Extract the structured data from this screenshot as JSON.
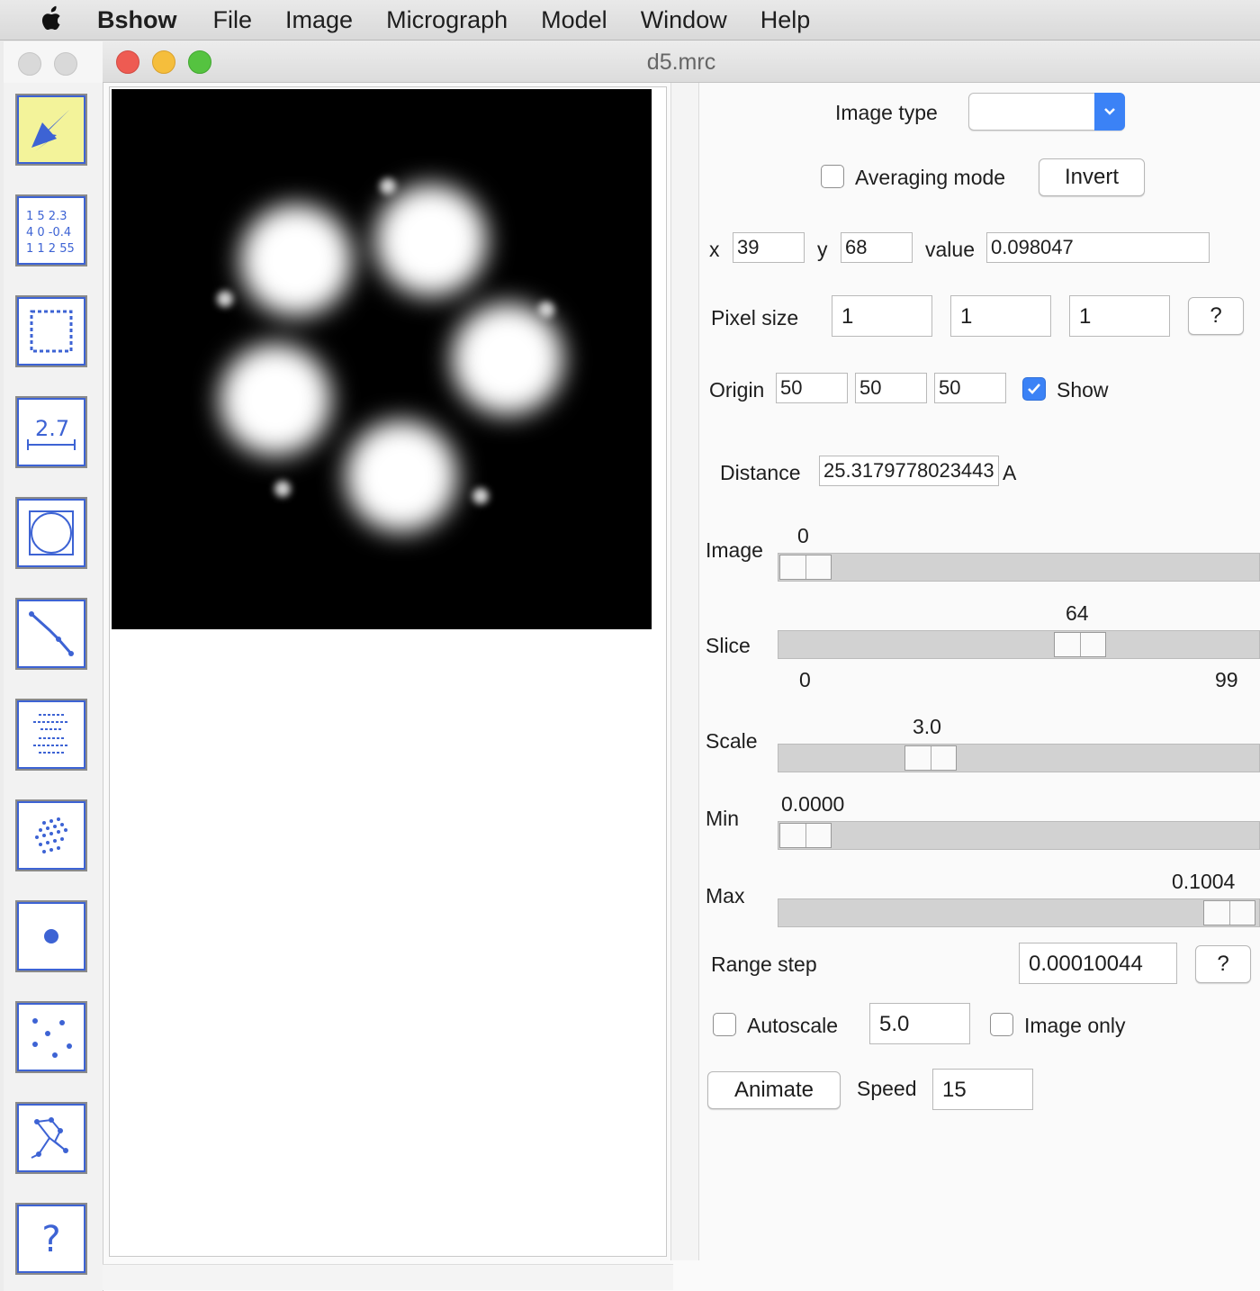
{
  "menubar": {
    "app": "Bshow",
    "items": [
      "File",
      "Image",
      "Micrograph",
      "Model",
      "Window",
      "Help"
    ]
  },
  "window": {
    "title": "d5.mrc"
  },
  "panel": {
    "image_type": {
      "label": "Image type",
      "value": ""
    },
    "averaging_mode": {
      "label": "Averaging mode",
      "checked": false
    },
    "invert_label": "Invert",
    "coords": {
      "x_label": "x",
      "x": "39",
      "y_label": "y",
      "y": "68",
      "value_label": "value",
      "value": "0.098047"
    },
    "pixel_size": {
      "label": "Pixel size",
      "x": "1",
      "y": "1",
      "z": "1",
      "help": "?"
    },
    "origin": {
      "label": "Origin",
      "x": "50",
      "y": "50",
      "z": "50",
      "show_label": "Show",
      "show_checked": true
    },
    "distance": {
      "label": "Distance",
      "value": "25.3179778023443",
      "unit": "A"
    },
    "image_slider": {
      "label": "Image",
      "value": "0",
      "min": 0,
      "max": 0,
      "position": 0
    },
    "slice_slider": {
      "label": "Slice",
      "value": "64",
      "min_label": "0",
      "max_label": "99",
      "min": 0,
      "max": 99
    },
    "scale_slider": {
      "label": "Scale",
      "value": "3.0",
      "fraction": 0.29
    },
    "min_slider": {
      "label": "Min",
      "value": "0.0000",
      "fraction": 0.0
    },
    "max_slider": {
      "label": "Max",
      "value": "0.1004",
      "fraction": 1.0
    },
    "range_step": {
      "label": "Range step",
      "value": "0.00010044",
      "help": "?"
    },
    "autoscale": {
      "label": "Autoscale",
      "checked": false,
      "value": "5.0"
    },
    "image_only": {
      "label": "Image only",
      "checked": false
    },
    "animate_label": "Animate",
    "speed": {
      "label": "Speed",
      "value": "15"
    }
  },
  "tools": [
    "pointer-tool-icon",
    "values-tool-icon",
    "box-select-tool-icon",
    "measure-tool-icon",
    "circle-tool-icon",
    "line-tool-icon",
    "filament-tool-icon",
    "lattice-tool-icon",
    "point-tool-icon",
    "scatter-points-tool-icon",
    "model-tool-icon",
    "help-tool-icon"
  ],
  "tool_values_icon_text": [
    "1 5 2.3",
    "4 0 -0.4",
    "1 1 2 55"
  ],
  "tool_measure_icon_text": "2.7",
  "tool_help_icon_text": "?",
  "colors": {
    "accent": "#3b82f6",
    "tool_border": "#3d63d4",
    "active_tool": "#f3f39a"
  }
}
